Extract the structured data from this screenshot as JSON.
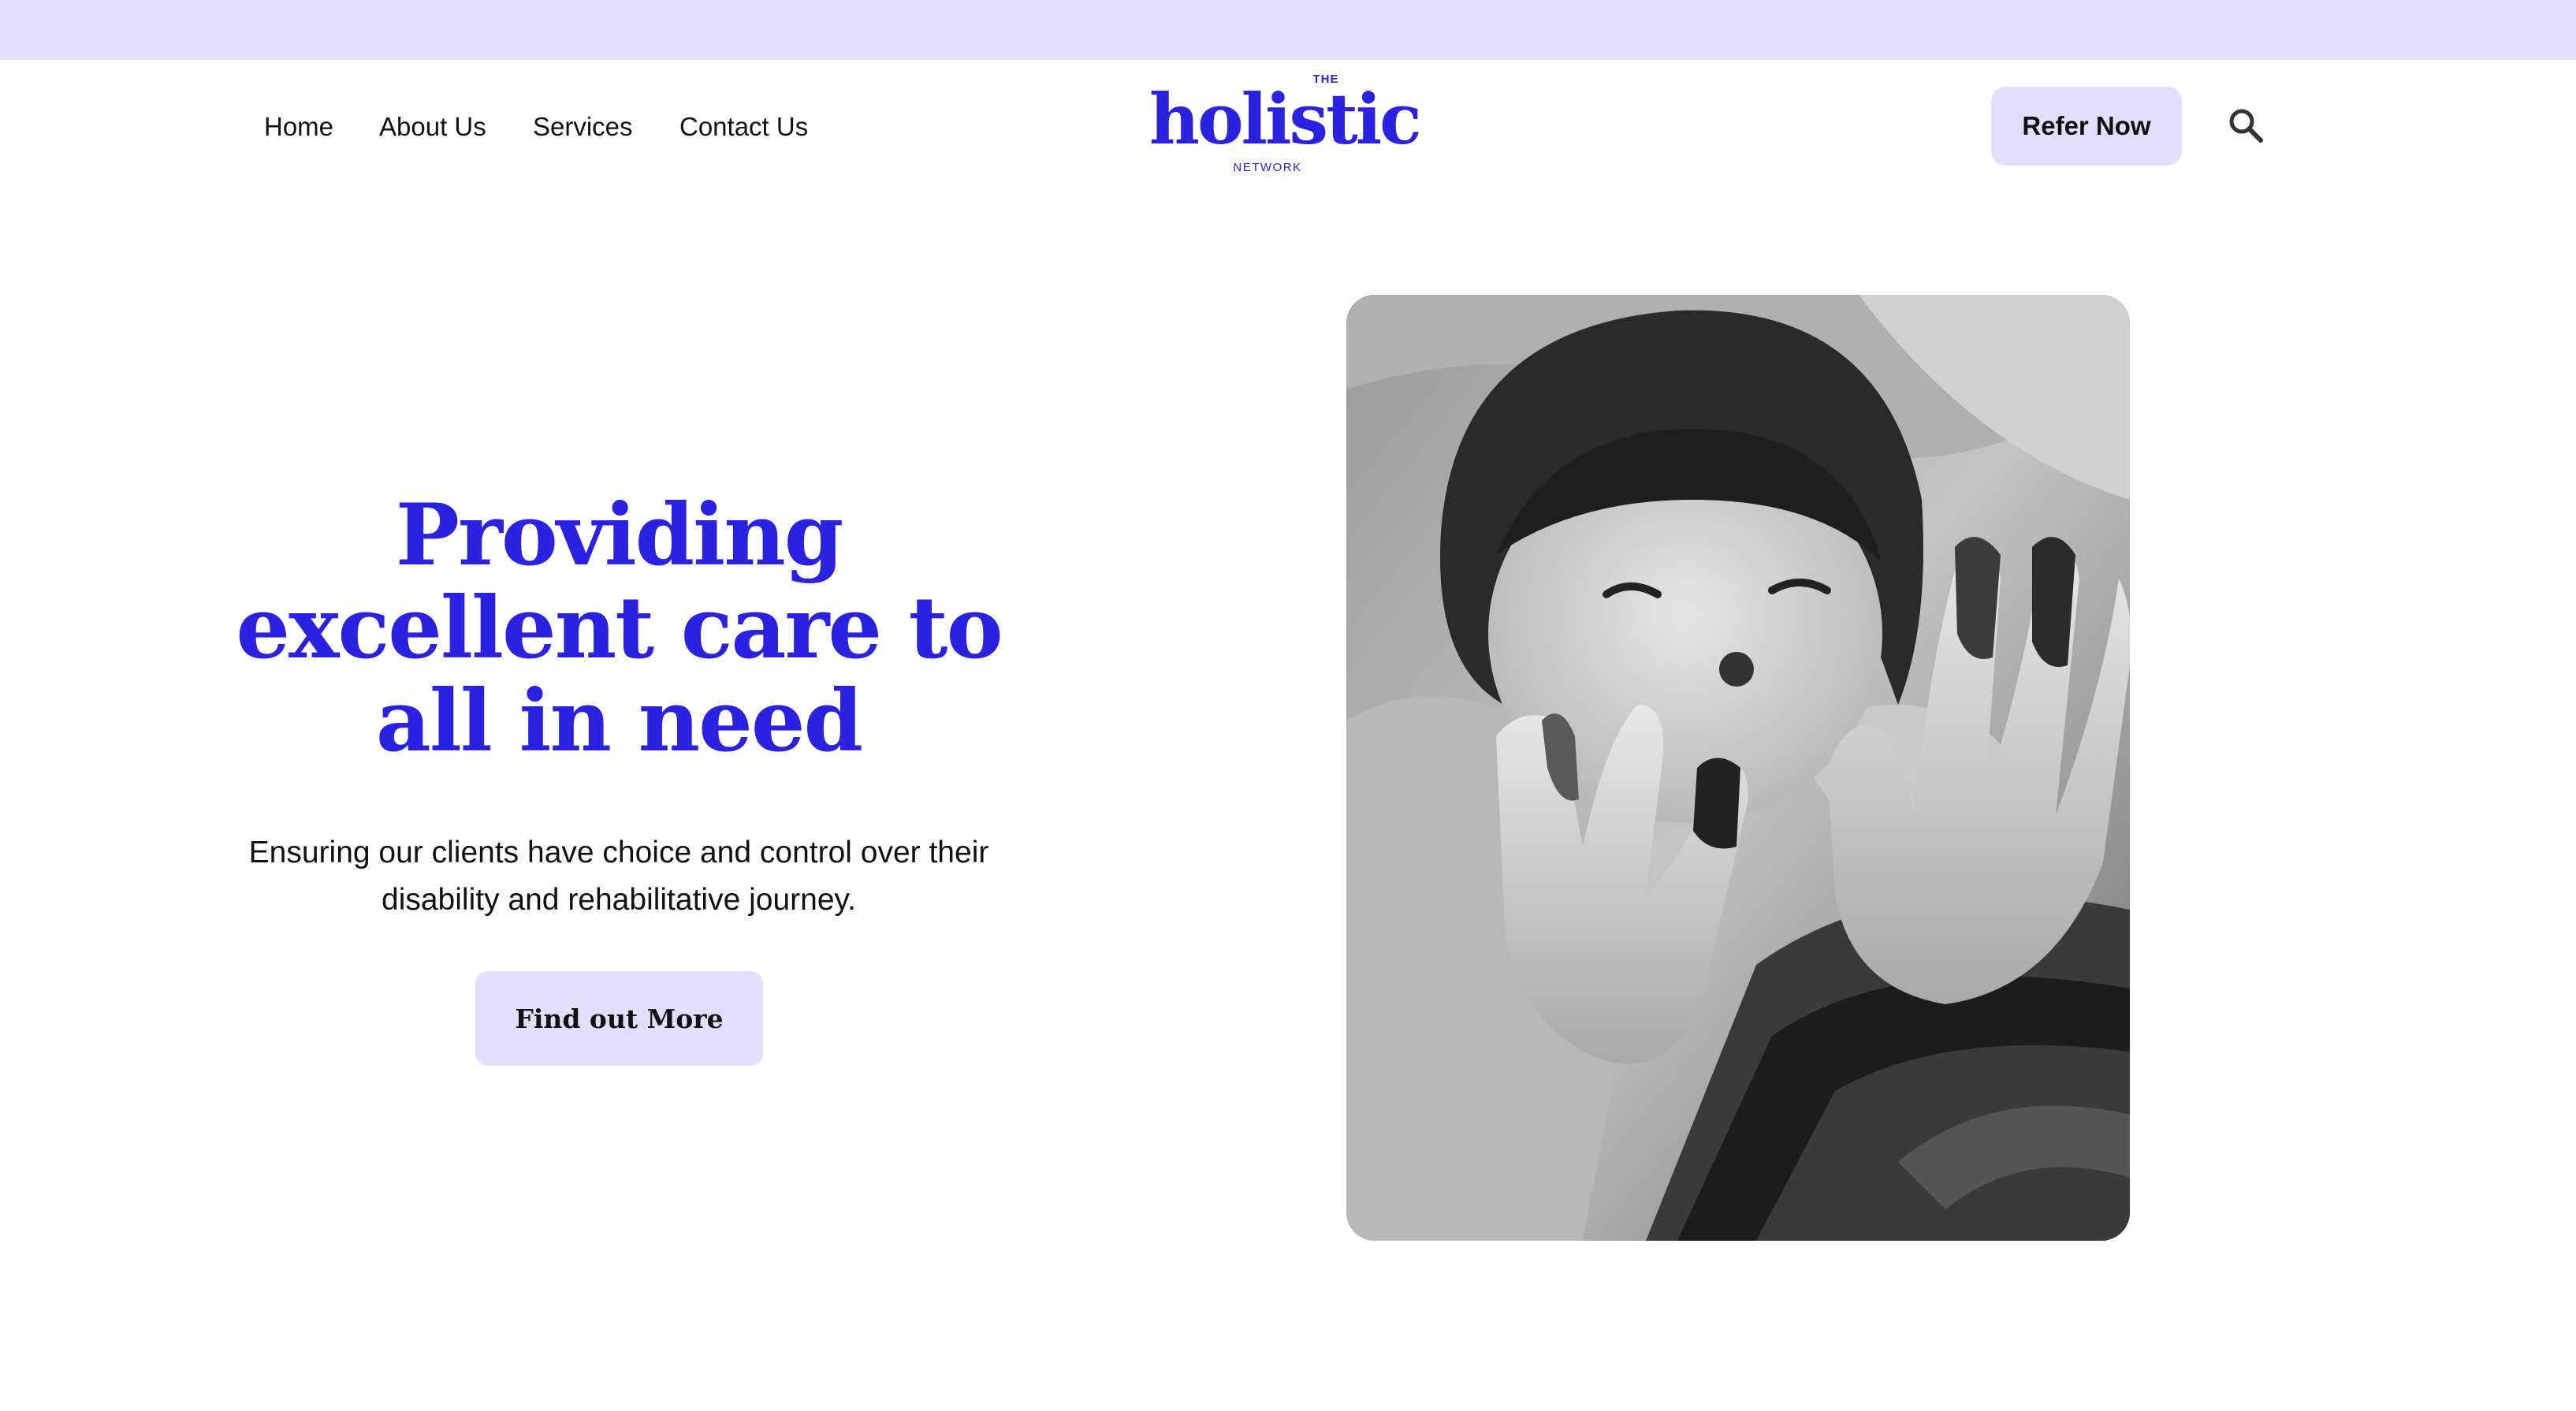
{
  "nav": {
    "home": "Home",
    "about": "About Us",
    "services": "Services",
    "contact": "Contact Us"
  },
  "logo": {
    "prefix": "THE",
    "name": "holistic",
    "suffix": "NETWORK"
  },
  "header": {
    "refer_label": "Refer Now",
    "search_icon": "search-icon"
  },
  "hero": {
    "title": "Providing excellent care to all in need",
    "subtitle": "Ensuring our clients have choice and control over their disability and rehabilitative journey.",
    "cta_label": "Find out More",
    "image": "photo of child with paint-covered hands"
  },
  "colors": {
    "accent": "#2a22e0",
    "button_bg": "#e2dffd",
    "top_bar": "#e2dffd"
  }
}
